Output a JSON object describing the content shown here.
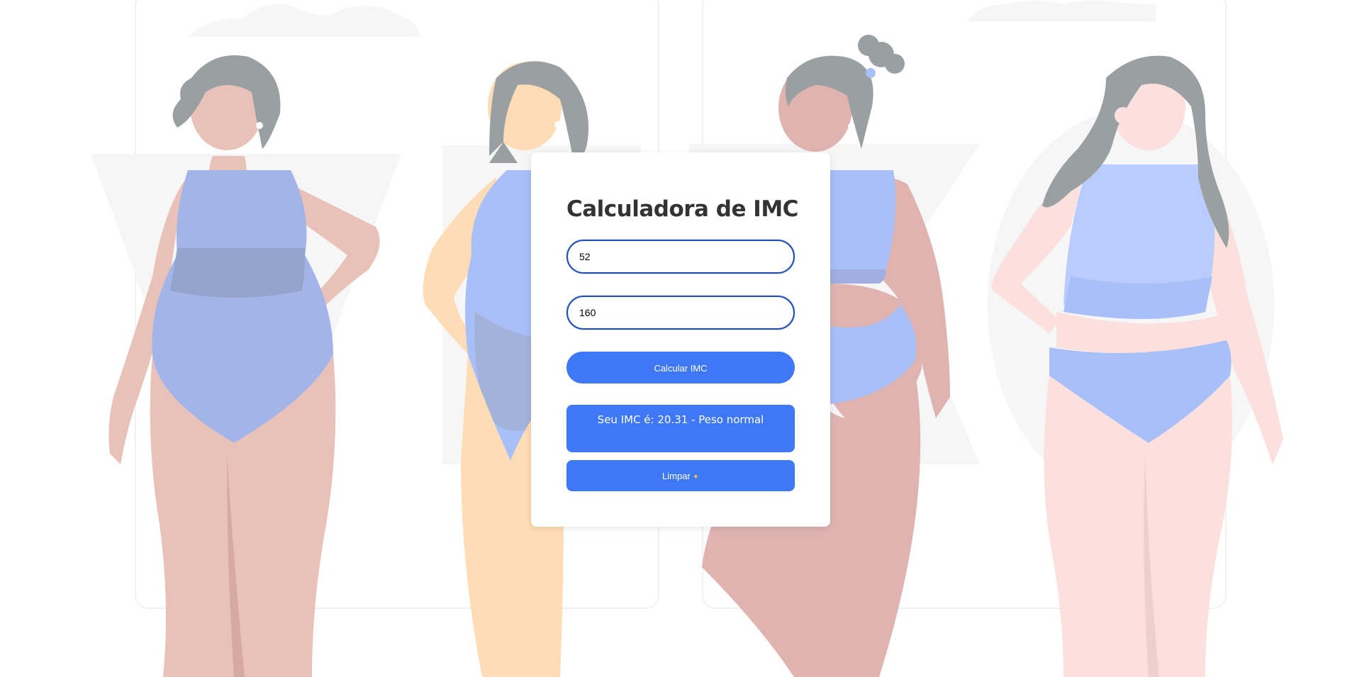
{
  "calculator": {
    "title": "Calculadora de IMC",
    "weight_value": "52",
    "height_value": "160",
    "calc_label": "Calcular IMC",
    "result_text": "Seu IMC é: 20.31 - Peso normal",
    "clear_label": "Limpar",
    "clear_icon": "broom-icon"
  },
  "colors": {
    "button": "#3f78f6",
    "field_border": "#1e4db7",
    "title": "#333333"
  }
}
